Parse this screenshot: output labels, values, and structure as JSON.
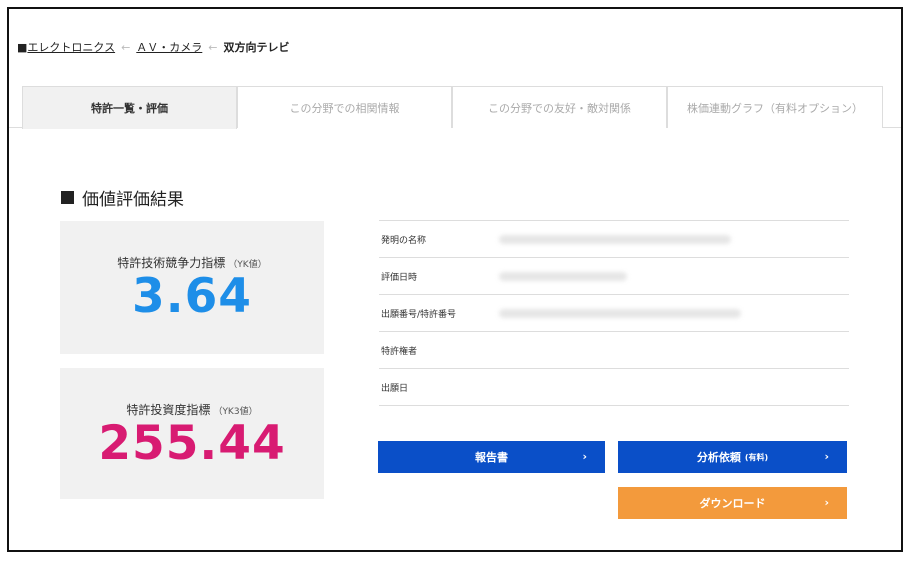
{
  "breadcrumb": {
    "prefix": "■",
    "items": [
      "エレクトロニクス",
      "ＡＶ・カメラ"
    ],
    "separator": "←",
    "current": "双方向テレビ"
  },
  "tabs": [
    {
      "label": "特許一覧・評価",
      "active": true
    },
    {
      "label": "この分野での相関情報",
      "active": false
    },
    {
      "label": "この分野での友好・敵対関係",
      "active": false
    },
    {
      "label": "株価連動グラフ（有料オプション）",
      "active": false
    }
  ],
  "section": {
    "title": "価値評価結果"
  },
  "scores": {
    "competitiveness": {
      "label": "特許技術競争力指標",
      "sub": "（YK値）",
      "value": "3.64",
      "color": "#1e8ee8"
    },
    "investment": {
      "label": "特許投資度指標",
      "sub": "（YK3値）",
      "value": "255.44",
      "color": "#d81b72"
    }
  },
  "info_rows": [
    {
      "label": "発明の名称",
      "redacted": true
    },
    {
      "label": "評価日時",
      "redacted": true
    },
    {
      "label": "出願番号/特許番号",
      "redacted": true
    },
    {
      "label": "特許権者",
      "redacted": false
    },
    {
      "label": "出願日",
      "redacted": false
    }
  ],
  "buttons": {
    "report": "報告書",
    "analysis": "分析依頼",
    "analysis_sub": "(有料)",
    "download": "ダウンロード",
    "chevron": "›"
  },
  "colors": {
    "primary_button": "#0a4fc8",
    "download_button": "#f39a3c"
  }
}
